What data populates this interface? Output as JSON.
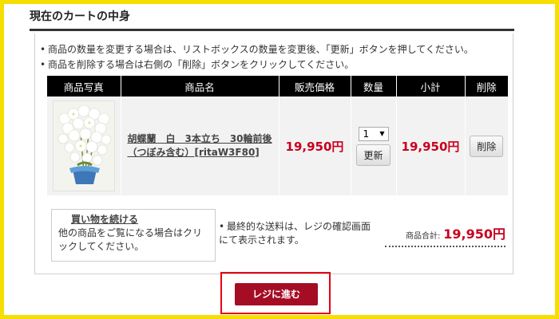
{
  "section_title": "現在のカートの中身",
  "notes": [
    "商品の数量を変更する場合は、リストボックスの数量を変更後、「更新」ボタンを押してください。",
    "商品を削除する場合は右側の「削除」ボタンをクリックしてください。"
  ],
  "table": {
    "headers": [
      "商品写真",
      "商品名",
      "販売価格",
      "数量",
      "小計",
      "削除"
    ],
    "row": {
      "name_line1": "胡蝶蘭　白　3本立ち　30輪前後",
      "name_line2": "（つぼみ含む）[ritaW3F80]",
      "price": "19,950円",
      "quantity": "1",
      "update_label": "更新",
      "subtotal": "19,950円",
      "delete_label": "削除"
    }
  },
  "continue_box": {
    "link": "買い物を続ける",
    "text": "他の商品をご覧になる場合はクリックしてください。"
  },
  "shipping_note": "最終的な送料は、レジの確認画面にて表示されます。",
  "total": {
    "label": "商品合計:",
    "value": "19,950円"
  },
  "checkout_label": "レジに進む",
  "colors": {
    "frame": "#f5de00",
    "price": "#c8001e",
    "checkout": "#a50d25",
    "highlight": "#e60012"
  }
}
